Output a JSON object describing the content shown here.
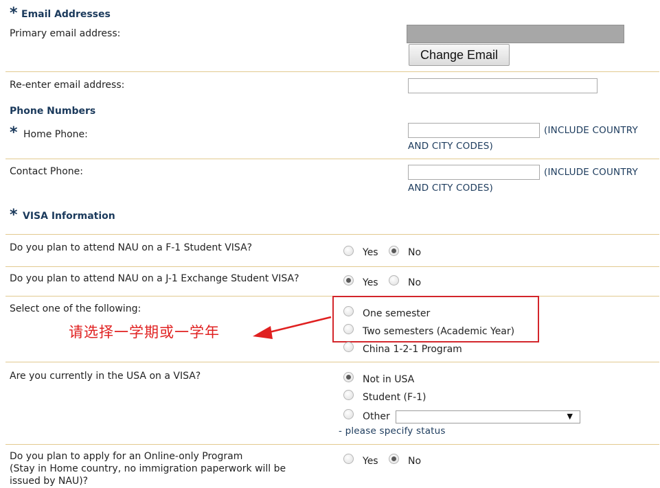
{
  "email_section": {
    "title": "Email Addresses",
    "primary_label": "Primary email address:",
    "change_button": "Change Email",
    "reenter_label": "Re-enter email address:",
    "reenter_value": ""
  },
  "phone_section": {
    "title": "Phone Numbers",
    "home_label": "Home Phone:",
    "contact_label": "Contact Phone:",
    "codes_note_line1": "(INCLUDE COUNTRY",
    "codes_note_line2": "AND CITY CODES)"
  },
  "visa_section": {
    "title": "VISA Information",
    "f1_question": "Do you plan to attend NAU on a F-1 Student VISA?",
    "f1_selected": "No",
    "j1_question": "Do you plan to attend NAU on a J-1 Exchange Student VISA?",
    "j1_selected": "Yes",
    "yes_label": "Yes",
    "no_label": "No",
    "select_label": "Select one of the following:",
    "program_options": [
      "One semester",
      "Two semesters (Academic Year)",
      "China 1-2-1 Program"
    ],
    "annotation_cn": "请选择一学期或一学年",
    "annotation_color": "#d3252a",
    "in_usa_question": "Are you currently in the USA on a VISA?",
    "in_usa_options": [
      "Not in USA",
      "Student (F-1)",
      "Other"
    ],
    "in_usa_selected": "Not in USA",
    "other_select_value": "",
    "other_note": "- please specify status",
    "online_question_line1": "Do you plan to apply for an Online-only Program",
    "online_question_line2": "(Stay in Home country, no immigration paperwork will be",
    "online_question_line3": "issued by NAU)?",
    "online_selected": "No"
  },
  "colors": {
    "heading": "#1b3a5c",
    "separator": "#e2c98e",
    "highlight": "#d3252a"
  }
}
